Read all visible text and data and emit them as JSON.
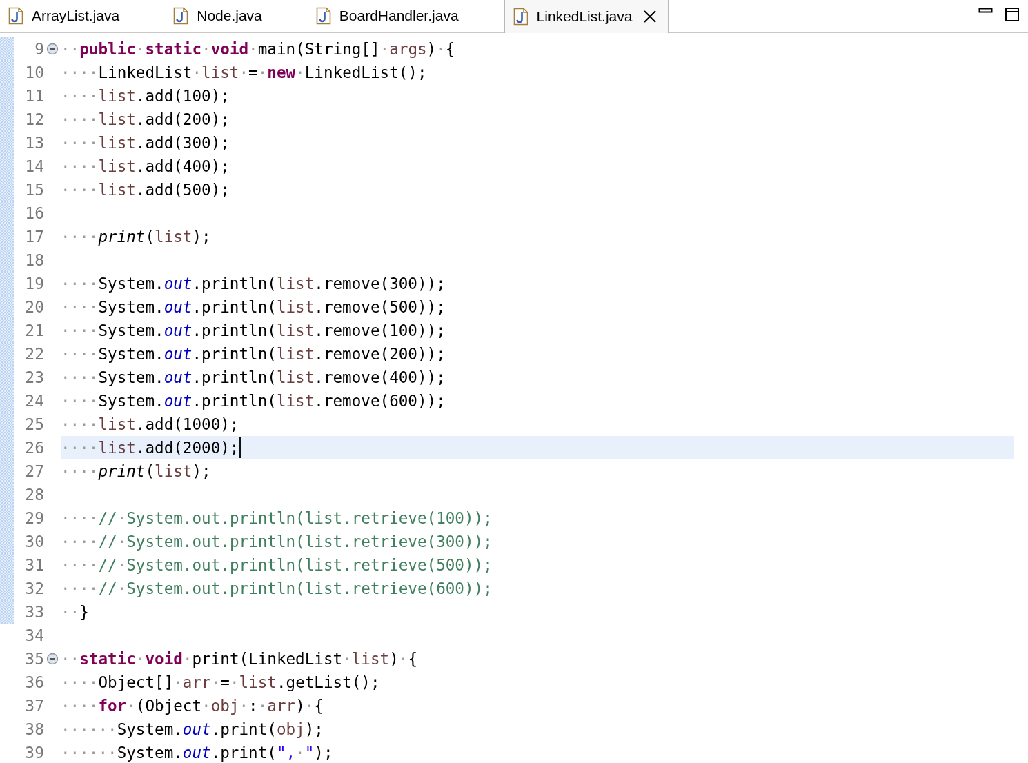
{
  "tabs": [
    {
      "label": "ArrayList.java",
      "selected": false
    },
    {
      "label": "Node.java",
      "selected": false
    },
    {
      "label": "BoardHandler.java",
      "selected": false
    },
    {
      "label": "LinkedList.java",
      "selected": true
    }
  ],
  "editor": {
    "lines": [
      {
        "number": "9",
        "fold": true,
        "current": false,
        "in_range": true,
        "tokens": [
          {
            "kind": "ws",
            "text": "··"
          },
          {
            "kind": "kw",
            "text": "public"
          },
          {
            "kind": "ws",
            "text": "·"
          },
          {
            "kind": "kw",
            "text": "static"
          },
          {
            "kind": "ws",
            "text": "·"
          },
          {
            "kind": "kw",
            "text": "void"
          },
          {
            "kind": "ws",
            "text": "·"
          },
          {
            "kind": "plain",
            "text": "main(String[]"
          },
          {
            "kind": "ws",
            "text": "·"
          },
          {
            "kind": "var",
            "text": "args"
          },
          {
            "kind": "plain",
            "text": ")"
          },
          {
            "kind": "ws",
            "text": "·"
          },
          {
            "kind": "plain",
            "text": "{"
          }
        ]
      },
      {
        "number": "10",
        "fold": false,
        "current": false,
        "in_range": true,
        "tokens": [
          {
            "kind": "ws",
            "text": "····"
          },
          {
            "kind": "plain",
            "text": "LinkedList"
          },
          {
            "kind": "ws",
            "text": "·"
          },
          {
            "kind": "var",
            "text": "list"
          },
          {
            "kind": "ws",
            "text": "·"
          },
          {
            "kind": "plain",
            "text": "="
          },
          {
            "kind": "ws",
            "text": "·"
          },
          {
            "kind": "kw",
            "text": "new"
          },
          {
            "kind": "ws",
            "text": "·"
          },
          {
            "kind": "plain",
            "text": "LinkedList();"
          }
        ]
      },
      {
        "number": "11",
        "fold": false,
        "current": false,
        "in_range": true,
        "tokens": [
          {
            "kind": "ws",
            "text": "····"
          },
          {
            "kind": "var",
            "text": "list"
          },
          {
            "kind": "plain",
            "text": ".add(100);"
          }
        ]
      },
      {
        "number": "12",
        "fold": false,
        "current": false,
        "in_range": true,
        "tokens": [
          {
            "kind": "ws",
            "text": "····"
          },
          {
            "kind": "var",
            "text": "list"
          },
          {
            "kind": "plain",
            "text": ".add(200);"
          }
        ]
      },
      {
        "number": "13",
        "fold": false,
        "current": false,
        "in_range": true,
        "tokens": [
          {
            "kind": "ws",
            "text": "····"
          },
          {
            "kind": "var",
            "text": "list"
          },
          {
            "kind": "plain",
            "text": ".add(300);"
          }
        ]
      },
      {
        "number": "14",
        "fold": false,
        "current": false,
        "in_range": true,
        "tokens": [
          {
            "kind": "ws",
            "text": "····"
          },
          {
            "kind": "var",
            "text": "list"
          },
          {
            "kind": "plain",
            "text": ".add(400);"
          }
        ]
      },
      {
        "number": "15",
        "fold": false,
        "current": false,
        "in_range": true,
        "tokens": [
          {
            "kind": "ws",
            "text": "····"
          },
          {
            "kind": "var",
            "text": "list"
          },
          {
            "kind": "plain",
            "text": ".add(500);"
          }
        ]
      },
      {
        "number": "16",
        "fold": false,
        "current": false,
        "in_range": true
      },
      {
        "number": "17",
        "fold": false,
        "current": false,
        "in_range": true,
        "tokens": [
          {
            "kind": "ws",
            "text": "····"
          },
          {
            "kind": "static",
            "text": "print"
          },
          {
            "kind": "plain",
            "text": "("
          },
          {
            "kind": "var",
            "text": "list"
          },
          {
            "kind": "plain",
            "text": ");"
          }
        ]
      },
      {
        "number": "18",
        "fold": false,
        "current": false,
        "in_range": true
      },
      {
        "number": "19",
        "fold": false,
        "current": false,
        "in_range": true,
        "tokens": [
          {
            "kind": "ws",
            "text": "····"
          },
          {
            "kind": "plain",
            "text": "System."
          },
          {
            "kind": "field",
            "text": "out"
          },
          {
            "kind": "plain",
            "text": ".println("
          },
          {
            "kind": "var",
            "text": "list"
          },
          {
            "kind": "plain",
            "text": ".remove(300));"
          }
        ]
      },
      {
        "number": "20",
        "fold": false,
        "current": false,
        "in_range": true,
        "tokens": [
          {
            "kind": "ws",
            "text": "····"
          },
          {
            "kind": "plain",
            "text": "System."
          },
          {
            "kind": "field",
            "text": "out"
          },
          {
            "kind": "plain",
            "text": ".println("
          },
          {
            "kind": "var",
            "text": "list"
          },
          {
            "kind": "plain",
            "text": ".remove(500));"
          }
        ]
      },
      {
        "number": "21",
        "fold": false,
        "current": false,
        "in_range": true,
        "tokens": [
          {
            "kind": "ws",
            "text": "····"
          },
          {
            "kind": "plain",
            "text": "System."
          },
          {
            "kind": "field",
            "text": "out"
          },
          {
            "kind": "plain",
            "text": ".println("
          },
          {
            "kind": "var",
            "text": "list"
          },
          {
            "kind": "plain",
            "text": ".remove(100));"
          }
        ]
      },
      {
        "number": "22",
        "fold": false,
        "current": false,
        "in_range": true,
        "tokens": [
          {
            "kind": "ws",
            "text": "····"
          },
          {
            "kind": "plain",
            "text": "System."
          },
          {
            "kind": "field",
            "text": "out"
          },
          {
            "kind": "plain",
            "text": ".println("
          },
          {
            "kind": "var",
            "text": "list"
          },
          {
            "kind": "plain",
            "text": ".remove(200));"
          }
        ]
      },
      {
        "number": "23",
        "fold": false,
        "current": false,
        "in_range": true,
        "tokens": [
          {
            "kind": "ws",
            "text": "····"
          },
          {
            "kind": "plain",
            "text": "System."
          },
          {
            "kind": "field",
            "text": "out"
          },
          {
            "kind": "plain",
            "text": ".println("
          },
          {
            "kind": "var",
            "text": "list"
          },
          {
            "kind": "plain",
            "text": ".remove(400));"
          }
        ]
      },
      {
        "number": "24",
        "fold": false,
        "current": false,
        "in_range": true,
        "tokens": [
          {
            "kind": "ws",
            "text": "····"
          },
          {
            "kind": "plain",
            "text": "System."
          },
          {
            "kind": "field",
            "text": "out"
          },
          {
            "kind": "plain",
            "text": ".println("
          },
          {
            "kind": "var",
            "text": "list"
          },
          {
            "kind": "plain",
            "text": ".remove(600));"
          }
        ]
      },
      {
        "number": "25",
        "fold": false,
        "current": false,
        "in_range": true,
        "tokens": [
          {
            "kind": "ws",
            "text": "····"
          },
          {
            "kind": "var",
            "text": "list"
          },
          {
            "kind": "plain",
            "text": ".add(1000);"
          }
        ]
      },
      {
        "number": "26",
        "fold": false,
        "current": true,
        "in_range": true,
        "tokens": [
          {
            "kind": "ws",
            "text": "····"
          },
          {
            "kind": "var",
            "text": "list"
          },
          {
            "kind": "plain",
            "text": ".add(2000);"
          }
        ]
      },
      {
        "number": "27",
        "fold": false,
        "current": false,
        "in_range": true,
        "tokens": [
          {
            "kind": "ws",
            "text": "····"
          },
          {
            "kind": "static",
            "text": "print"
          },
          {
            "kind": "plain",
            "text": "("
          },
          {
            "kind": "var",
            "text": "list"
          },
          {
            "kind": "plain",
            "text": ");"
          }
        ]
      },
      {
        "number": "28",
        "fold": false,
        "current": false,
        "in_range": true
      },
      {
        "number": "29",
        "fold": false,
        "current": false,
        "in_range": true,
        "tokens": [
          {
            "kind": "ws",
            "text": "····"
          },
          {
            "kind": "comment",
            "text": "//"
          },
          {
            "kind": "ws",
            "text": "·"
          },
          {
            "kind": "comment",
            "text": "System.out.println(list.retrieve(100));"
          }
        ]
      },
      {
        "number": "30",
        "fold": false,
        "current": false,
        "in_range": true,
        "tokens": [
          {
            "kind": "ws",
            "text": "····"
          },
          {
            "kind": "comment",
            "text": "//"
          },
          {
            "kind": "ws",
            "text": "·"
          },
          {
            "kind": "comment",
            "text": "System.out.println(list.retrieve(300));"
          }
        ]
      },
      {
        "number": "31",
        "fold": false,
        "current": false,
        "in_range": true,
        "tokens": [
          {
            "kind": "ws",
            "text": "····"
          },
          {
            "kind": "comment",
            "text": "//"
          },
          {
            "kind": "ws",
            "text": "·"
          },
          {
            "kind": "comment",
            "text": "System.out.println(list.retrieve(500));"
          }
        ]
      },
      {
        "number": "32",
        "fold": false,
        "current": false,
        "in_range": true,
        "tokens": [
          {
            "kind": "ws",
            "text": "····"
          },
          {
            "kind": "comment",
            "text": "//"
          },
          {
            "kind": "ws",
            "text": "·"
          },
          {
            "kind": "comment",
            "text": "System.out.println(list.retrieve(600));"
          }
        ]
      },
      {
        "number": "33",
        "fold": false,
        "current": false,
        "in_range": true,
        "tokens": [
          {
            "kind": "ws",
            "text": "··"
          },
          {
            "kind": "plain",
            "text": "}"
          }
        ]
      },
      {
        "number": "34",
        "fold": false,
        "current": false,
        "in_range": false
      },
      {
        "number": "35",
        "fold": true,
        "current": false,
        "in_range": false,
        "tokens": [
          {
            "kind": "ws",
            "text": "··"
          },
          {
            "kind": "kw",
            "text": "static"
          },
          {
            "kind": "ws",
            "text": "·"
          },
          {
            "kind": "kw",
            "text": "void"
          },
          {
            "kind": "ws",
            "text": "·"
          },
          {
            "kind": "plain",
            "text": "print(LinkedList"
          },
          {
            "kind": "ws",
            "text": "·"
          },
          {
            "kind": "var",
            "text": "list"
          },
          {
            "kind": "plain",
            "text": ")"
          },
          {
            "kind": "ws",
            "text": "·"
          },
          {
            "kind": "plain",
            "text": "{"
          }
        ]
      },
      {
        "number": "36",
        "fold": false,
        "current": false,
        "in_range": false,
        "tokens": [
          {
            "kind": "ws",
            "text": "····"
          },
          {
            "kind": "plain",
            "text": "Object[]"
          },
          {
            "kind": "ws",
            "text": "·"
          },
          {
            "kind": "var",
            "text": "arr"
          },
          {
            "kind": "ws",
            "text": "·"
          },
          {
            "kind": "plain",
            "text": "="
          },
          {
            "kind": "ws",
            "text": "·"
          },
          {
            "kind": "var",
            "text": "list"
          },
          {
            "kind": "plain",
            "text": ".getList();"
          }
        ]
      },
      {
        "number": "37",
        "fold": false,
        "current": false,
        "in_range": false,
        "tokens": [
          {
            "kind": "ws",
            "text": "····"
          },
          {
            "kind": "kw",
            "text": "for"
          },
          {
            "kind": "ws",
            "text": "·"
          },
          {
            "kind": "plain",
            "text": "(Object"
          },
          {
            "kind": "ws",
            "text": "·"
          },
          {
            "kind": "var",
            "text": "obj"
          },
          {
            "kind": "ws",
            "text": "·"
          },
          {
            "kind": "plain",
            "text": ":"
          },
          {
            "kind": "ws",
            "text": "·"
          },
          {
            "kind": "var",
            "text": "arr"
          },
          {
            "kind": "plain",
            "text": ")"
          },
          {
            "kind": "ws",
            "text": "·"
          },
          {
            "kind": "plain",
            "text": "{"
          }
        ]
      },
      {
        "number": "38",
        "fold": false,
        "current": false,
        "in_range": false,
        "tokens": [
          {
            "kind": "ws",
            "text": "······"
          },
          {
            "kind": "plain",
            "text": "System."
          },
          {
            "kind": "field",
            "text": "out"
          },
          {
            "kind": "plain",
            "text": ".print("
          },
          {
            "kind": "var",
            "text": "obj"
          },
          {
            "kind": "plain",
            "text": ");"
          }
        ]
      },
      {
        "number": "39",
        "fold": false,
        "current": false,
        "in_range": false,
        "tokens": [
          {
            "kind": "ws",
            "text": "······"
          },
          {
            "kind": "plain",
            "text": "System."
          },
          {
            "kind": "field",
            "text": "out"
          },
          {
            "kind": "plain",
            "text": ".print("
          },
          {
            "kind": "string",
            "text": "\","
          },
          {
            "kind": "ws",
            "text": "·"
          },
          {
            "kind": "string",
            "text": "\""
          },
          {
            "kind": "plain",
            "text": ");"
          }
        ]
      }
    ]
  }
}
